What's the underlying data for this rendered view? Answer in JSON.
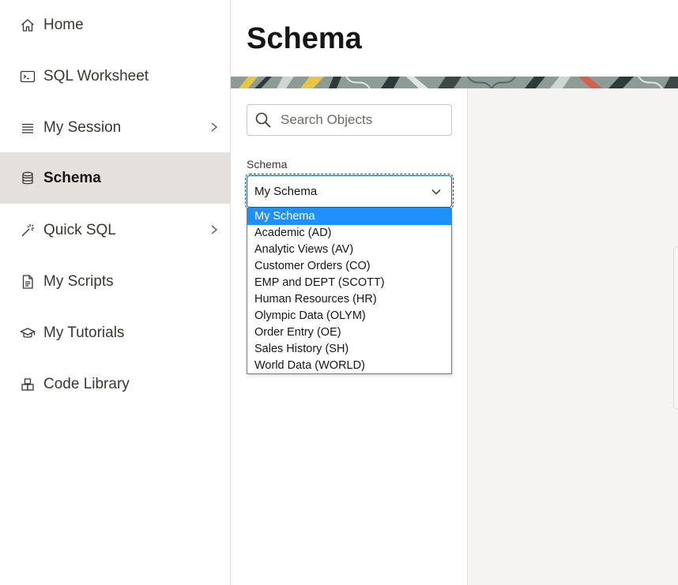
{
  "sidebar": {
    "items": [
      {
        "label": "Home",
        "icon": "home-icon"
      },
      {
        "label": "SQL Worksheet",
        "icon": "terminal-icon"
      },
      {
        "label": "My Session",
        "icon": "list-icon",
        "has_submenu": true
      },
      {
        "label": "Schema",
        "icon": "database-icon",
        "active": true
      },
      {
        "label": "Quick SQL",
        "icon": "magic-wand-icon",
        "has_submenu": true
      },
      {
        "label": "My Scripts",
        "icon": "document-icon"
      },
      {
        "label": "My Tutorials",
        "icon": "graduation-cap-icon"
      },
      {
        "label": "Code Library",
        "icon": "blocks-icon"
      }
    ]
  },
  "header": {
    "title": "Schema"
  },
  "search": {
    "placeholder": "Search Objects",
    "value": ""
  },
  "schema_select": {
    "label": "Schema",
    "selected": "My Schema",
    "options": [
      "My Schema",
      "Academic (AD)",
      "Analytic Views (AV)",
      "Customer Orders (CO)",
      "EMP and DEPT (SCOTT)",
      "Human Resources (HR)",
      "Olympic Data (OLYM)",
      "Order Entry (OE)",
      "Sales History (SH)",
      "World Data (WORLD)"
    ]
  },
  "colors": {
    "active_nav_bg": "#e4e1dd",
    "highlight": "#1e90ff",
    "text": "#161513"
  }
}
